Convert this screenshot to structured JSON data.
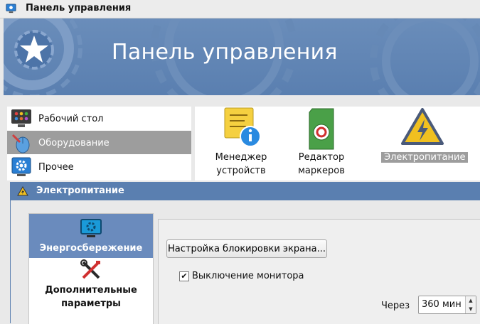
{
  "window": {
    "title": "Панель управления",
    "title_icon": "monitor-gear-icon"
  },
  "banner": {
    "heading": "Панель управления",
    "logo_icon": "star-gear-icon"
  },
  "categories": [
    {
      "label": "Рабочий стол",
      "icon": "desktop-apps-icon",
      "selected": false
    },
    {
      "label": "Оборудование",
      "icon": "hardware-mouse-icon",
      "selected": true
    },
    {
      "label": "Прочее",
      "icon": "other-gear-icon",
      "selected": false
    }
  ],
  "applets": [
    {
      "label_line1": "Менеджер",
      "label_line2": "устройств",
      "icon": "device-manager-icon"
    },
    {
      "label_line1": "Редактор",
      "label_line2": "маркеров",
      "icon": "token-editor-icon"
    },
    {
      "label_line1": "Электропитание",
      "label_line2": "",
      "icon": "power-warning-icon",
      "selected": true
    }
  ],
  "dialog": {
    "title": "Электропитание",
    "title_icon": "power-warning-icon",
    "side_items": [
      {
        "label": "Энергосбережение",
        "icon": "monitor-gear-icon",
        "selected": true
      },
      {
        "label_line1": "Дополнительные",
        "label_line2": "параметры",
        "icon": "tools-icon",
        "selected": false
      }
    ],
    "lock_button": "Настройка блокировки экрана...",
    "monitor_off": {
      "label": "Выключение монитора",
      "checked": true,
      "mark": "✔"
    },
    "after_label": "Через",
    "after_value": "360 мин",
    "spin_up": "▲",
    "spin_down": "▼"
  },
  "colors": {
    "accent": "#5a7fb0",
    "selection": "#9d9d9d",
    "side_selection": "#6a8bbd"
  }
}
